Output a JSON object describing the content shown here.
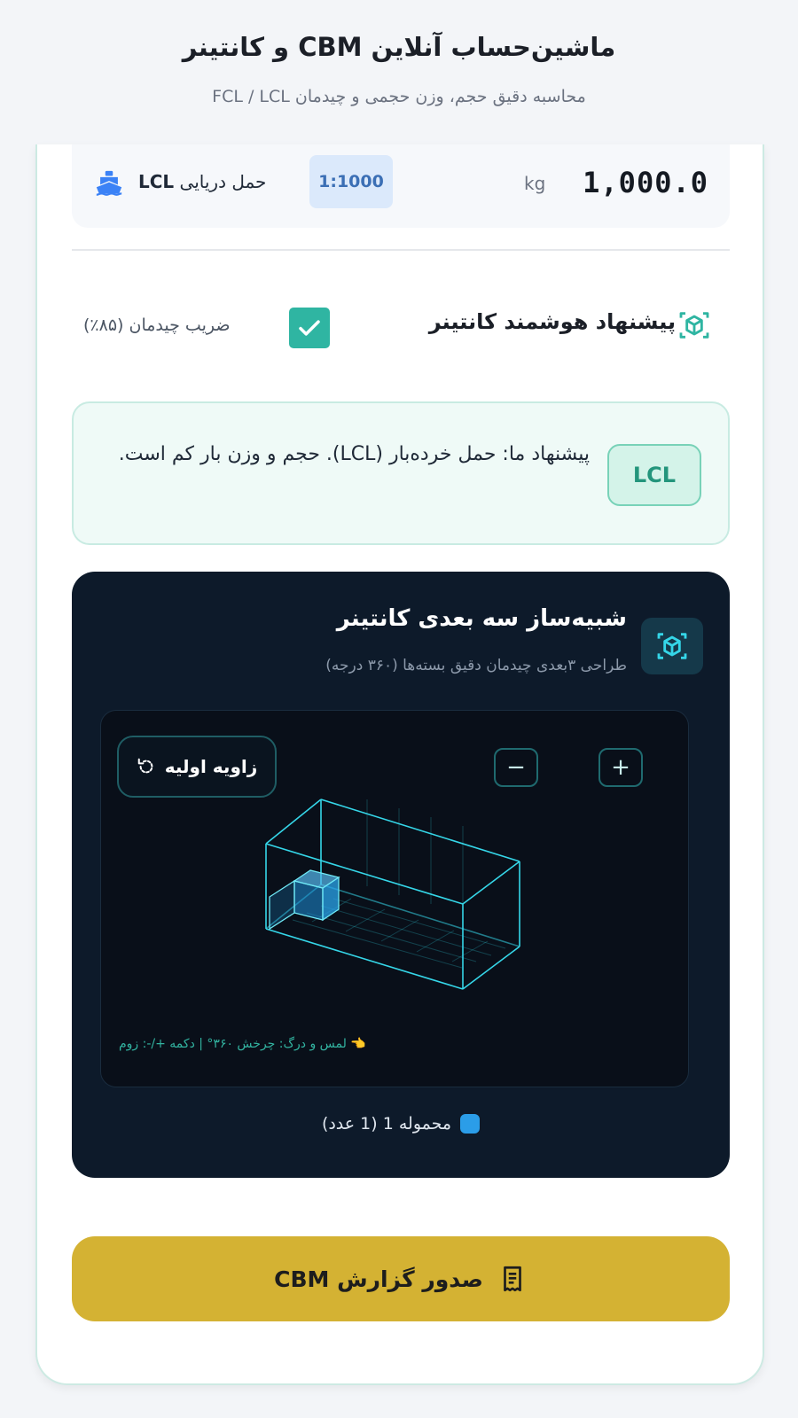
{
  "header": {
    "title": "ماشین‌حساب آنلاین CBM و کانتینر",
    "subtitle": "محاسبه دقیق حجم، وزن حجمی و چیدمان FCL / LCL"
  },
  "weight_row": {
    "value": "1,000.0",
    "unit": "kg",
    "ratio": "1:1000",
    "mode_prefix": "حمل دریایی",
    "mode_code": "LCL",
    "icon": "ship-icon"
  },
  "smart": {
    "title": "پیشنهاد هوشمند کانتینر",
    "icon": "cube-icon",
    "checkbox_label": "ضریب چیدمان (۸۵٪)",
    "checkbox_checked": true
  },
  "suggestion": {
    "tag": "LCL",
    "text": "پیشنهاد ما: حمل خرده‌بار (LCL). حجم و وزن بار کم است."
  },
  "simulator": {
    "title": "شبیه‌ساز سه بعدی کانتینر",
    "subtitle": "طراحی ۳بعدی چیدمان دقیق بسته‌ها (۳۶۰ درجه)",
    "reset_label": "زاویه اولیه",
    "zoom_in": "+",
    "zoom_out": "−",
    "hint": "👈 لمس و درگ: چرخش ۳۶۰° | دکمه +/-: زوم",
    "legend": "محموله 1 (1 عدد)",
    "legend_color": "#2b9de8",
    "accent_color": "#35d6e8"
  },
  "report_button": {
    "label": "صدور گزارش CBM",
    "icon": "receipt-icon",
    "color": "#d4b233"
  }
}
